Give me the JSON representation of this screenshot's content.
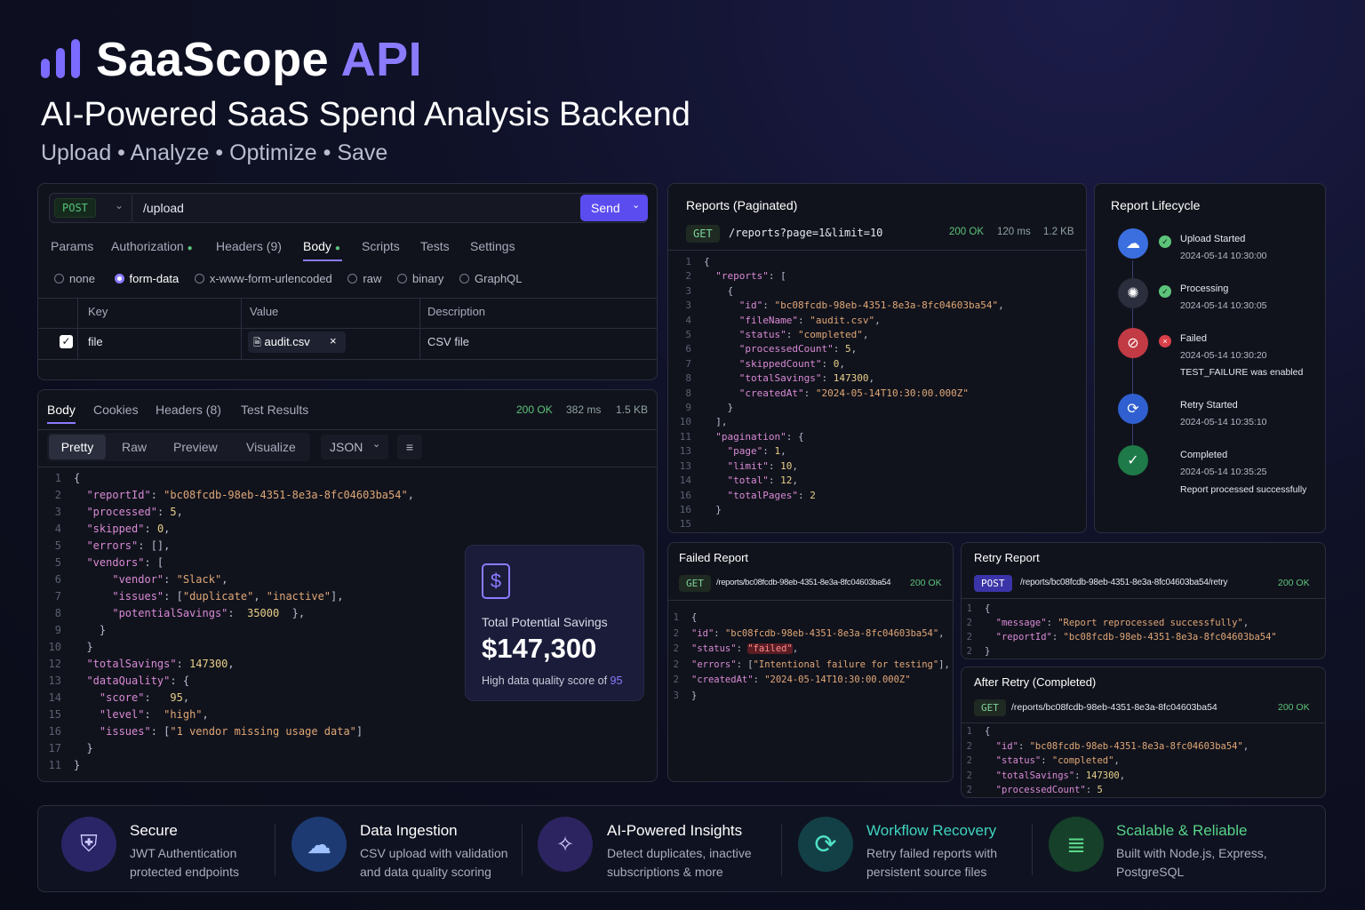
{
  "header": {
    "brand": "SaaScope",
    "brand_accent": "API",
    "title": "AI-Powered SaaS Spend Analysis Backend",
    "subtitle": "Upload • Analyze • Optimize • Save"
  },
  "request": {
    "method": "POST",
    "url": "/upload",
    "send_label": "Send",
    "tabs": [
      "Params",
      "Authorization",
      "Headers (9)",
      "Body",
      "Scripts",
      "Tests",
      "Settings"
    ],
    "body_types": [
      "none",
      "form-data",
      "x-www-form-urlencoded",
      "raw",
      "binary",
      "GraphQL"
    ],
    "table": {
      "headers": [
        "Key",
        "Value",
        "Description"
      ],
      "row": {
        "key": "file",
        "value": "audit.csv",
        "description": "CSV file"
      }
    }
  },
  "response": {
    "tabs": [
      "Body",
      "Cookies",
      "Headers (8)",
      "Test Results"
    ],
    "status": "200 OK",
    "time": "382 ms",
    "size": "1.5 KB",
    "view_tabs": [
      "Pretty",
      "Raw",
      "Preview",
      "Visualize"
    ],
    "format": "JSON"
  },
  "savings": {
    "label": "Total Potential Savings",
    "amount": "$147,300",
    "note": "High data quality score of",
    "score": "95"
  },
  "reports": {
    "title": "Reports (Paginated)",
    "method": "GET",
    "url": "/reports?page=1&limit=10",
    "status": "200 OK",
    "time": "120 ms",
    "size": "1.2 KB"
  },
  "lifecycle": {
    "title": "Report Lifecycle",
    "steps": [
      {
        "name": "Upload Started",
        "time": "2024-05-14 10:30:00",
        "note": ""
      },
      {
        "name": "Processing",
        "time": "2024-05-14 10:30:05",
        "note": ""
      },
      {
        "name": "Failed",
        "time": "2024-05-14 10:30:20",
        "note": "TEST_FAILURE was enabled"
      },
      {
        "name": "Retry Started",
        "time": "2024-05-14 10:35:10",
        "note": ""
      },
      {
        "name": "Completed",
        "time": "2024-05-14 10:35:25",
        "note": "Report processed successfully"
      }
    ]
  },
  "failed": {
    "title": "Failed Report",
    "method": "GET",
    "url": "/reports/bc08fcdb-98eb-4351-8e3a-8fc04603ba54",
    "status": "200 OK"
  },
  "retry": {
    "title": "Retry Report",
    "method": "POST",
    "url": "/reports/bc08fcdb-98eb-4351-8e3a-8fc04603ba54/retry",
    "status": "200 OK"
  },
  "after": {
    "title": "After Retry (Completed)",
    "method": "GET",
    "url": "/reports/bc08fcdb-98eb-4351-8e3a-8fc04603ba54",
    "status": "200 OK"
  },
  "features": [
    {
      "title": "Secure",
      "desc": "JWT Authentication protected endpoints",
      "icon": "shield-icon"
    },
    {
      "title": "Data Ingestion",
      "desc": "CSV upload with validation and data quality scoring",
      "icon": "cloud-upload-icon"
    },
    {
      "title": "AI-Powered Insights",
      "desc": "Detect duplicates, inactive subscriptions & more",
      "icon": "ai-insights-icon"
    },
    {
      "title": "Workflow Recovery",
      "desc": "Retry failed reports with persistent source files",
      "icon": "refresh-icon"
    },
    {
      "title": "Scalable & Reliable",
      "desc": "Built with Node.js, Express, PostgreSQL",
      "icon": "database-icon"
    }
  ],
  "colors": {
    "accent": "#8b7bff",
    "success": "#5cc47a",
    "error": "#d9404a",
    "teal": "#2dbfa5"
  }
}
